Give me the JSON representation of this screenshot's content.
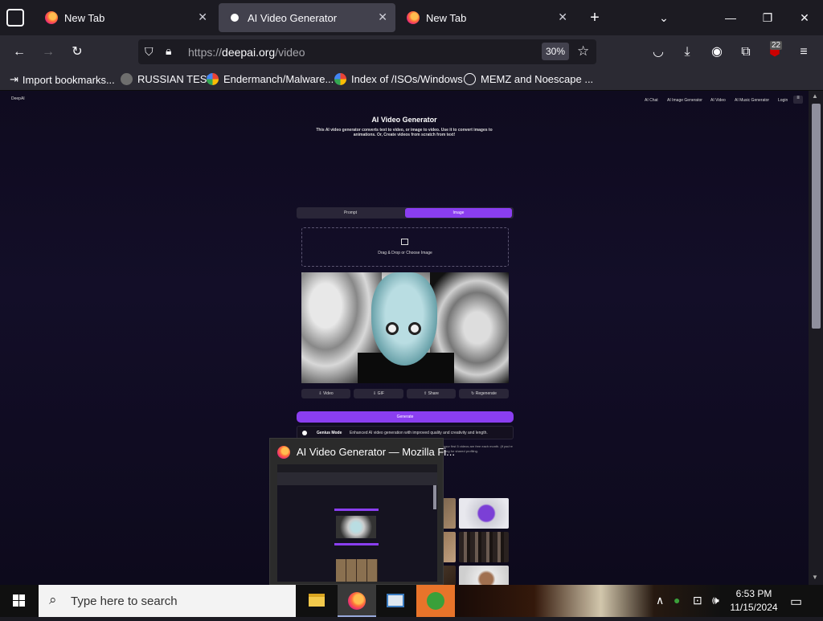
{
  "browser": {
    "tabs": [
      {
        "label": "New Tab",
        "active": false
      },
      {
        "label": "AI Video Generator",
        "active": true
      },
      {
        "label": "New Tab",
        "active": false
      }
    ],
    "url_scheme": "https://",
    "url_domain": "deepai.org",
    "url_path": "/video",
    "zoom": "30%",
    "extensions_badge": "22",
    "bookmarks": [
      {
        "label": "Import bookmarks...",
        "icon": "import-icon"
      },
      {
        "label": "RUSSIAN TEST",
        "icon": "github-icon"
      },
      {
        "label": "Endermanch/Malware...",
        "icon": "google-icon"
      },
      {
        "label": "Index of /ISOs/Windows",
        "icon": "google-icon"
      },
      {
        "label": "MEMZ and Noescape ...",
        "icon": "globe-icon"
      }
    ]
  },
  "site": {
    "logo": "DeepAI",
    "nav": [
      "AI Chat",
      "AI Image Generator",
      "AI Video",
      "AI Music Generator",
      "Login"
    ],
    "title": "AI Video Generator",
    "description": "This AI video generator converts text to video, or image to video. Use it to convert images to animations. Or, Create videos from scratch from text!",
    "tabs": {
      "prompt": "Prompt",
      "image": "Image"
    },
    "dropzone": "Drag & Drop or Choose Image",
    "actions": [
      "Video",
      "GIF",
      "Share",
      "Regenerate"
    ],
    "generate": "Generate",
    "genius_label": "Genius Mode",
    "genius_desc": "Enhanced AI video generation with improved quality and creativity and length.",
    "note": "your first 5 videos are free each month. (if you’re long for shared profiling."
  },
  "hover_preview": {
    "title": "AI Video Generator — Mozilla Fi..."
  },
  "taskbar": {
    "search_placeholder": "Type here to search",
    "time": "6:53 PM",
    "date": "11/15/2024"
  }
}
